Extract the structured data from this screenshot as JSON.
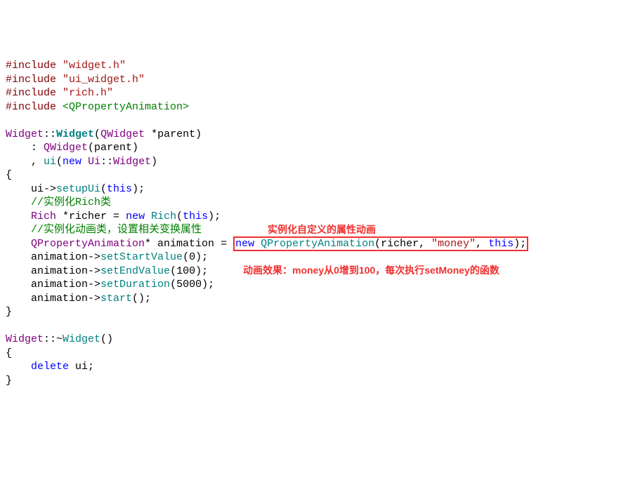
{
  "code": {
    "inc1_kw": "#include",
    "inc1_path": "\"widget.h\"",
    "inc2_kw": "#include",
    "inc2_path": "\"ui_widget.h\"",
    "inc3_kw": "#include",
    "inc3_path": "\"rich.h\"",
    "inc4_kw": "#include",
    "inc4_path": "<QPropertyAnimation>",
    "ctor_cls1": "Widget",
    "ctor_sep1": "::",
    "ctor_name": "Widget",
    "ctor_paren_open": "(",
    "ctor_ptype": "QWidget",
    "ctor_pstar": " *parent)",
    "init1_indent": "    : ",
    "init1_type": "QWidget",
    "init1_args": "(parent)",
    "init2_indent": "    , ",
    "init2_member": "ui",
    "init2_par_open": "(",
    "init2_new": "new",
    "init2_sp": " ",
    "init2_ns": "Ui",
    "init2_sep": "::",
    "init2_cls": "Widget",
    "init2_par_close": ")",
    "brace_open": "{",
    "line_setup_indent": "    ui->",
    "line_setup_fn": "setupUi",
    "line_setup_par_open": "(",
    "line_setup_this": "this",
    "line_setup_par_close": ");",
    "cmt1_indent": "    ",
    "cmt1": "//实例化Rich类",
    "rich_indent": "    ",
    "rich_type": "Rich",
    "rich_sp_star": " *richer = ",
    "rich_new": "new",
    "rich_sp2": " ",
    "rich_ctor": "Rich",
    "rich_par_open": "(",
    "rich_this": "this",
    "rich_par_close": ");",
    "cmt2_indent": "    ",
    "cmt2": "//实例化动画类，设置相关变换属性",
    "anim_decl_indent": "    ",
    "anim_decl_type": "QPropertyAnimation",
    "anim_decl_mid": "* animation = ",
    "anim_new": "new",
    "anim_sp": " ",
    "anim_ctor": "QPropertyAnimation",
    "anim_args_open": "(richer, ",
    "anim_str": "\"money\"",
    "anim_args_mid": ", ",
    "anim_this": "this",
    "anim_args_close": ");",
    "sv_indent": "    animation->",
    "sv_fn": "setStartValue",
    "sv_args": "(0);",
    "ev_indent": "    animation->",
    "ev_fn": "setEndValue",
    "ev_args": "(100);",
    "sd_indent": "    animation->",
    "sd_fn": "setDuration",
    "sd_args": "(5000);",
    "st_indent": "    animation->",
    "st_fn": "start",
    "st_args": "();",
    "brace_close": "}",
    "dtor_cls": "Widget",
    "dtor_sep": "::~",
    "dtor_name": "Widget",
    "dtor_paren": "()",
    "dtor_brace_open": "{",
    "dtor_indent": "    ",
    "dtor_delete": "delete",
    "dtor_sp": " ui;",
    "dtor_brace_close": "}"
  },
  "annotations": {
    "a1": "实例化自定义的属性动画",
    "a2": "动画效果：money从0增到100，每次执行setMoney的函数"
  }
}
